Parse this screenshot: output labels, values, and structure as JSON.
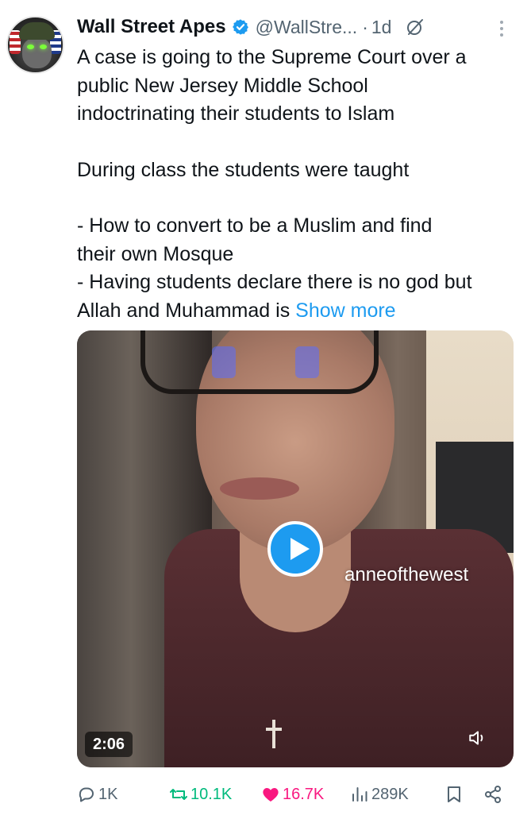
{
  "post": {
    "author_name": "Wall Street Apes",
    "handle": "@WallStre...",
    "separator": "·",
    "age": "1d",
    "text_lines": [
      "A case is going to the Supreme Court over a",
      "public New Jersey Middle School",
      "indoctrinating their students to Islam",
      "During class the students were taught",
      "- How to convert to be a Muslim and find",
      "their own Mosque",
      "- Having students declare there is no god but"
    ],
    "last_line_text": "Allah and Muhammad is ",
    "show_more_label": "Show more"
  },
  "media": {
    "watermark": "anneofthewest",
    "duration": "2:06"
  },
  "actions": {
    "replies": "1K",
    "reposts": "10.1K",
    "likes": "16.7K",
    "views": "289K"
  },
  "colors": {
    "accent": "#1d9bf0",
    "repost": "#00ba7c",
    "like": "#f91880",
    "muted": "#536471"
  },
  "icons": [
    "verified-badge-icon",
    "grok-icon",
    "more-icon",
    "play-icon",
    "mute-icon",
    "reply-icon",
    "repost-icon",
    "like-icon",
    "views-icon",
    "bookmark-icon",
    "share-icon"
  ]
}
